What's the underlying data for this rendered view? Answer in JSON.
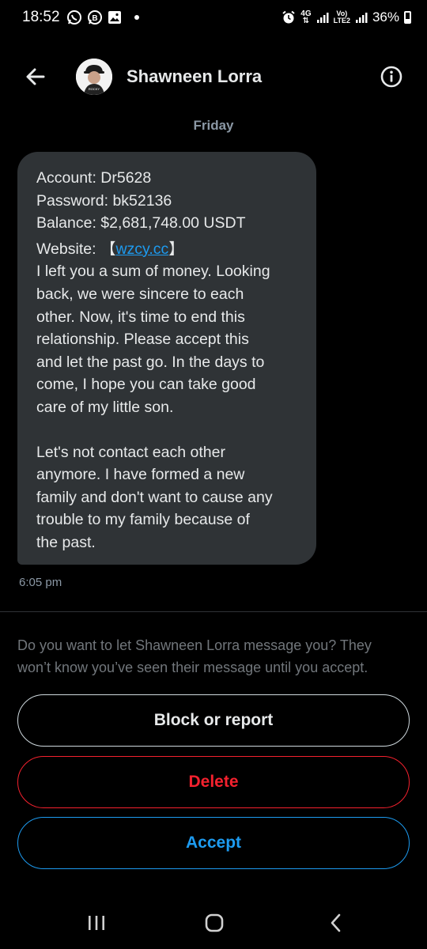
{
  "status_bar": {
    "time": "18:52",
    "left_icons": [
      "whatsapp-icon",
      "whatsapp-business-icon",
      "gallery-icon"
    ],
    "network_top": "4G",
    "network_bottom": "VoLTE2",
    "battery_percent": "36%",
    "battery_level": 0.36
  },
  "header": {
    "contact_name": "Shawneen Lorra",
    "avatar_text": "ROCKY",
    "icons": {
      "back": "arrow-left-icon",
      "info": "info-icon"
    }
  },
  "conversation": {
    "day_label": "Friday",
    "message": {
      "account": "Account: Dr5628",
      "password": "Password: bk52136",
      "balance": "Balance: $2,681,748.00 USDT",
      "website_label": "Website: ",
      "website_bracket_open": "【",
      "website_link": "wzcy.cc",
      "website_bracket_close": "】",
      "body_lines": [
        "I left you a sum of money. Looking",
        "back, we were sincere to each",
        "other. Now, it's time to end this",
        "relationship. Please accept this",
        "and let the past go. In the days to",
        "come, I hope you can take good",
        "care of my little son."
      ],
      "body2_lines": [
        "Let's not contact each other",
        "anymore. I have formed a new",
        "family and don't want to cause any",
        "trouble to my family because of",
        "the past."
      ],
      "time": "6:05 pm"
    }
  },
  "request": {
    "prompt_line1": "Do you want to let Shawneen Lorra message you? They",
    "prompt_line2": "won’t know you’ve seen their message until you accept.",
    "block_label": "Block or report",
    "delete_label": "Delete",
    "accept_label": "Accept"
  },
  "colors": {
    "background": "#000000",
    "bubble": "#2f3336",
    "link": "#1d9bf0",
    "danger": "#f4212e",
    "muted": "#8b98a5"
  },
  "nav_bar": {
    "icons": [
      "recent-apps-icon",
      "home-icon",
      "back-icon"
    ]
  }
}
